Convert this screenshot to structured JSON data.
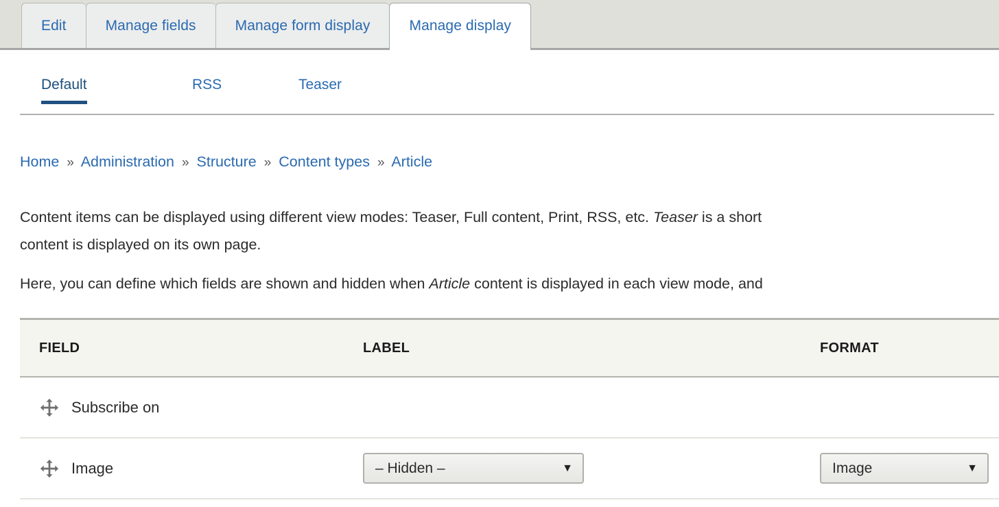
{
  "primary_tabs": [
    {
      "label": "Edit",
      "active": false
    },
    {
      "label": "Manage fields",
      "active": false
    },
    {
      "label": "Manage form display",
      "active": false
    },
    {
      "label": "Manage display",
      "active": true
    }
  ],
  "secondary_tabs": [
    {
      "label": "Default",
      "active": true
    },
    {
      "label": "RSS",
      "active": false
    },
    {
      "label": "Teaser",
      "active": false
    }
  ],
  "breadcrumb": {
    "items": [
      "Home",
      "Administration",
      "Structure",
      "Content types",
      "Article"
    ],
    "separator": "»"
  },
  "description": {
    "paragraph1_a": "Content items can be displayed using different view modes: Teaser, Full content, Print, RSS, etc. ",
    "paragraph1_em": "Teaser",
    "paragraph1_b": " is a short\ncontent is displayed on its own page.",
    "paragraph2_a": "Here, you can define which fields are shown and hidden when ",
    "paragraph2_em": "Article",
    "paragraph2_b": " content is displayed in each view mode, and"
  },
  "table": {
    "headers": {
      "field": "FIELD",
      "label": "LABEL",
      "format": "FORMAT"
    },
    "rows": [
      {
        "field": "Subscribe on",
        "label_select": null,
        "format_select": null
      },
      {
        "field": "Image",
        "label_select": "– Hidden –",
        "format_select": "Image"
      }
    ]
  },
  "icons": {
    "drag_handle": "move-cross-icon",
    "select_caret": "▼"
  },
  "colors": {
    "link": "#2a6ab0",
    "active_underline": "#1f5180",
    "tabbar_bg": "#dfe0da",
    "tab_bg": "#eceded",
    "table_header_bg": "#f5f5f0"
  }
}
